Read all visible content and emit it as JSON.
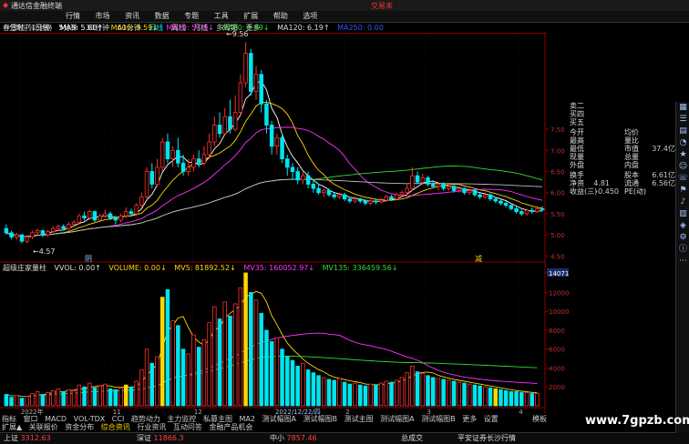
{
  "app": {
    "title": "通达信金融终端",
    "window_right_label": "交易未",
    "menu": [
      "行情",
      "市场",
      "资讯",
      "数据",
      "专题",
      "工具",
      "扩展",
      "帮助",
      "选项"
    ]
  },
  "periods": [
    "分时",
    "1分钟",
    "5分钟",
    "30分钟",
    "60分钟",
    "日线",
    "周线",
    "月线",
    "多周期",
    "更多"
  ],
  "active_period": "日线",
  "main_legend": {
    "stock": "春雪制药(日线)",
    "items": [
      {
        "label": "MA5: 5.60↑",
        "color": "#ffffff"
      },
      {
        "label": "MA10: 5.59↓",
        "color": "#ffd700"
      },
      {
        "label": "MA20: 5.75↓",
        "color": "#ff33ff"
      },
      {
        "label": "MA60: 5.89↓",
        "color": "#33dd33"
      },
      {
        "label": "MA120: 6.19↑",
        "color": "#dddddd"
      },
      {
        "label": "MA250: 0.00",
        "color": "#3355ff"
      }
    ]
  },
  "annotations": {
    "high": "9.56",
    "low": "4.57",
    "left_mark": "阴",
    "right_mark": "减"
  },
  "price_ticks": [
    "7.50",
    "7.00",
    "6.50",
    "6.00",
    "5.50",
    "5.00",
    "4.50"
  ],
  "sub_legend": {
    "title": "超级庄家量柱",
    "items": [
      {
        "label": "VVOL: 0.00↑",
        "color": "#dddddd"
      },
      {
        "label": "VOLUME: 0.00↓",
        "color": "#ffd700"
      },
      {
        "label": "MV5: 81892.52↓",
        "color": "#ffd700"
      },
      {
        "label": "MV35: 160052.97↓",
        "color": "#ff33ff"
      },
      {
        "label": "MV135: 336459.56↓",
        "color": "#33dd33"
      }
    ]
  },
  "volume_ticks": [
    "14071",
    "12000",
    "10000",
    "8000",
    "6000",
    "4000",
    "2000"
  ],
  "x_labels": [
    "2022年",
    "11",
    "12",
    "2022/12/22/四",
    "2",
    "3",
    "4"
  ],
  "quote_panel": {
    "book": [
      "卖二",
      "买四",
      "买五"
    ],
    "rows": [
      {
        "l1": "今开",
        "v1": "",
        "l2": "均价",
        "v2": ""
      },
      {
        "l1": "最高",
        "v1": "",
        "l2": "量比",
        "v2": ""
      },
      {
        "l1": "最低",
        "v1": "",
        "l2": "市值",
        "v2": "37.4亿"
      },
      {
        "l1": "现量",
        "v1": "",
        "l2": "总量",
        "v2": ""
      },
      {
        "l1": "外盘",
        "v1": "",
        "l2": "内盘",
        "v2": ""
      },
      {
        "l1": "换手",
        "v1": "",
        "l2": "股本",
        "v2": "6.61亿"
      },
      {
        "l1": "净资",
        "v1": "4.81",
        "l2": "流通",
        "v2": "6.56亿"
      },
      {
        "l1": "收益(三)",
        "v1": "-0.450",
        "l2": "PE(动)",
        "v2": ""
      }
    ]
  },
  "tabs_row1": [
    "指标",
    "窗口",
    "MACD",
    "VOL-TDX",
    "CCI",
    "趋势动力",
    "主力监控",
    "私募主图",
    "MA2",
    "测试幅图A",
    "测试幅图B",
    "测试主图",
    "测试幅图A",
    "测试幅图B",
    "更多",
    "设置"
  ],
  "tabs_row2": [
    "扩展▲",
    "关联报价",
    "资金分布",
    "综合资讯",
    "行业资讯",
    "互动问答",
    "金融产品机会"
  ],
  "tabs_row2_highlight": "综合资讯",
  "corner_labels": {
    "mode": "模板",
    "pager": "E"
  },
  "status": [
    {
      "label": "上证",
      "value": "3312.63",
      "color": "#ff4040"
    },
    {
      "label": "深证",
      "value": "11866.3",
      "color": "#ff4040"
    },
    {
      "label": "中小",
      "value": "7857.46",
      "color": "#ff4040"
    },
    {
      "label": "总成交",
      "value": "",
      "color": "#cccccc"
    },
    {
      "label": "平安证券长沙行情",
      "value": "",
      "color": "#cccccc"
    }
  ],
  "sidebar_icons": [
    "grid-icon",
    "list-icon",
    "chart-icon",
    "pie-icon",
    "star-icon",
    "user-icon",
    "phone-icon",
    "flag-icon",
    "bell-icon",
    "book-icon",
    "tag-icon",
    "gear-icon",
    "info-icon",
    "more-icon"
  ],
  "watermark": "www.7gpzb.com",
  "colors": {
    "up": "#ff3030",
    "down": "#00e5ee",
    "axis": "#8b0000",
    "accent": "#ffd700"
  },
  "chart_data": {
    "type": "candlestick+volume",
    "price_axis": {
      "ylim": [
        4.4,
        9.7
      ],
      "ticks": [
        4.5,
        5.0,
        5.5,
        6.0,
        6.5,
        7.0,
        7.5
      ]
    },
    "volume_axis": {
      "ylim": [
        0,
        14071
      ],
      "ticks": [
        2000,
        4000,
        6000,
        8000,
        10000,
        12000,
        14071
      ]
    },
    "candles": [
      [
        5.15,
        5.05,
        5.25,
        5.0
      ],
      [
        5.05,
        4.95,
        5.1,
        4.9
      ],
      [
        4.95,
        5.0,
        5.05,
        4.88
      ],
      [
        5.0,
        4.85,
        5.02,
        4.8
      ],
      [
        4.85,
        4.95,
        5.0,
        4.8
      ],
      [
        4.95,
        5.05,
        5.1,
        4.9
      ],
      [
        5.05,
        5.1,
        5.15,
        5.0
      ],
      [
        5.1,
        5.0,
        5.12,
        4.95
      ],
      [
        5.0,
        5.08,
        5.12,
        4.95
      ],
      [
        5.08,
        5.15,
        5.2,
        5.05
      ],
      [
        5.15,
        5.2,
        5.25,
        5.1
      ],
      [
        5.2,
        5.15,
        5.25,
        5.1
      ],
      [
        5.15,
        5.25,
        5.3,
        5.1
      ],
      [
        5.25,
        5.3,
        5.35,
        5.2
      ],
      [
        5.3,
        5.45,
        5.5,
        5.25
      ],
      [
        5.45,
        5.4,
        5.55,
        5.35
      ],
      [
        5.4,
        5.55,
        5.6,
        5.35
      ],
      [
        5.55,
        5.35,
        5.58,
        5.3
      ],
      [
        5.35,
        5.45,
        5.5,
        5.3
      ],
      [
        5.45,
        5.5,
        5.6,
        5.4
      ],
      [
        5.5,
        5.4,
        5.55,
        5.35
      ],
      [
        5.4,
        5.35,
        5.45,
        5.25
      ],
      [
        5.35,
        5.45,
        5.5,
        5.3
      ],
      [
        5.45,
        5.55,
        5.65,
        5.4
      ],
      [
        5.55,
        5.5,
        5.62,
        5.45
      ],
      [
        5.5,
        5.7,
        5.75,
        5.45
      ],
      [
        5.7,
        5.9,
        6.0,
        5.65
      ],
      [
        5.9,
        6.5,
        6.6,
        5.85
      ],
      [
        6.5,
        6.2,
        6.7,
        6.1
      ],
      [
        6.2,
        6.6,
        6.8,
        6.15
      ],
      [
        6.6,
        7.2,
        7.3,
        6.5
      ],
      [
        7.2,
        6.8,
        7.4,
        6.7
      ],
      [
        6.8,
        7.0,
        7.1,
        6.6
      ],
      [
        7.0,
        6.7,
        7.3,
        6.6
      ],
      [
        6.7,
        6.5,
        6.9,
        6.4
      ],
      [
        6.5,
        6.6,
        6.8,
        6.4
      ],
      [
        6.6,
        6.8,
        6.9,
        6.5
      ],
      [
        6.8,
        6.7,
        7.0,
        6.6
      ],
      [
        6.7,
        6.9,
        7.1,
        6.65
      ],
      [
        6.9,
        7.2,
        7.4,
        6.8
      ],
      [
        7.2,
        7.6,
        7.8,
        7.1
      ],
      [
        7.6,
        7.4,
        7.9,
        7.3
      ],
      [
        7.4,
        7.8,
        8.0,
        7.35
      ],
      [
        7.8,
        7.5,
        8.2,
        7.4
      ],
      [
        7.5,
        7.9,
        8.3,
        7.45
      ],
      [
        7.9,
        8.6,
        8.8,
        7.85
      ],
      [
        8.6,
        9.3,
        9.56,
        8.5
      ],
      [
        9.3,
        8.4,
        9.4,
        8.3
      ],
      [
        8.4,
        8.8,
        9.0,
        8.2
      ],
      [
        8.8,
        8.1,
        8.9,
        7.9
      ],
      [
        8.1,
        7.6,
        8.2,
        7.4
      ],
      [
        7.6,
        7.1,
        7.7,
        6.9
      ],
      [
        7.1,
        7.3,
        7.4,
        6.9
      ],
      [
        7.3,
        6.8,
        7.4,
        6.7
      ],
      [
        6.8,
        6.6,
        6.9,
        6.4
      ],
      [
        6.6,
        6.5,
        6.7,
        6.3
      ],
      [
        6.5,
        6.3,
        6.6,
        6.2
      ],
      [
        6.3,
        6.4,
        6.5,
        6.2
      ],
      [
        6.4,
        6.2,
        6.5,
        6.1
      ],
      [
        6.2,
        6.1,
        6.3,
        6.0
      ],
      [
        6.1,
        6.0,
        6.2,
        5.95
      ],
      [
        6.0,
        6.05,
        6.1,
        5.9
      ],
      [
        6.05,
        5.95,
        6.1,
        5.9
      ],
      [
        5.95,
        5.9,
        6.0,
        5.85
      ],
      [
        5.9,
        5.95,
        6.0,
        5.85
      ],
      [
        5.95,
        5.85,
        6.0,
        5.8
      ],
      [
        5.85,
        5.8,
        5.9,
        5.75
      ],
      [
        5.8,
        5.85,
        5.9,
        5.75
      ],
      [
        5.85,
        5.8,
        5.88,
        5.75
      ],
      [
        5.8,
        5.75,
        5.85,
        5.7
      ],
      [
        5.75,
        5.8,
        5.85,
        5.7
      ],
      [
        5.8,
        5.78,
        5.85,
        5.72
      ],
      [
        5.78,
        5.82,
        5.88,
        5.74
      ],
      [
        5.82,
        5.9,
        5.95,
        5.78
      ],
      [
        5.9,
        5.85,
        5.95,
        5.8
      ],
      [
        5.85,
        5.95,
        6.0,
        5.82
      ],
      [
        5.95,
        6.0,
        6.05,
        5.9
      ],
      [
        6.0,
        6.1,
        6.2,
        5.95
      ],
      [
        6.1,
        6.4,
        6.6,
        6.05
      ],
      [
        6.4,
        6.25,
        6.5,
        6.2
      ],
      [
        6.25,
        6.35,
        6.45,
        6.2
      ],
      [
        6.35,
        6.2,
        6.4,
        6.15
      ],
      [
        6.2,
        6.15,
        6.3,
        6.1
      ],
      [
        6.15,
        6.2,
        6.25,
        6.05
      ],
      [
        6.2,
        6.1,
        6.25,
        6.05
      ],
      [
        6.1,
        6.15,
        6.2,
        6.05
      ],
      [
        6.15,
        6.05,
        6.18,
        6.0
      ],
      [
        6.05,
        6.1,
        6.15,
        6.0
      ],
      [
        6.1,
        6.0,
        6.12,
        5.95
      ],
      [
        6.0,
        6.05,
        6.1,
        5.95
      ],
      [
        6.05,
        5.95,
        6.08,
        5.9
      ],
      [
        5.95,
        5.9,
        6.0,
        5.85
      ],
      [
        5.9,
        5.95,
        6.0,
        5.85
      ],
      [
        5.95,
        5.85,
        5.98,
        5.8
      ],
      [
        5.85,
        5.8,
        5.9,
        5.75
      ],
      [
        5.8,
        5.75,
        5.85,
        5.7
      ],
      [
        5.75,
        5.7,
        5.8,
        5.65
      ],
      [
        5.7,
        5.62,
        5.75,
        5.58
      ],
      [
        5.62,
        5.55,
        5.68,
        5.5
      ],
      [
        5.55,
        5.5,
        5.6,
        5.45
      ],
      [
        5.5,
        5.58,
        5.62,
        5.45
      ],
      [
        5.58,
        5.55,
        5.65,
        5.5
      ],
      [
        5.55,
        5.62,
        5.68,
        5.52
      ],
      [
        5.62,
        5.6,
        5.68,
        5.55
      ]
    ],
    "volumes": [
      1200,
      900,
      1100,
      800,
      1000,
      1300,
      1500,
      1200,
      1400,
      1600,
      1800,
      1500,
      1700,
      1600,
      2200,
      2000,
      2400,
      1900,
      2100,
      2300,
      1800,
      1700,
      1900,
      2200,
      2000,
      2600,
      3800,
      6000,
      4500,
      5200,
      11500,
      12300,
      9000,
      8500,
      6000,
      5500,
      7500,
      6200,
      7000,
      8800,
      10500,
      9200,
      11000,
      9500,
      10800,
      12500,
      14071,
      12000,
      11200,
      9800,
      8000,
      6800,
      7200,
      6000,
      5200,
      4800,
      4200,
      4500,
      3800,
      3500,
      3200,
      3000,
      2800,
      2700,
      2900,
      2500,
      2300,
      2400,
      2200,
      2100,
      2300,
      2200,
      2400,
      2600,
      2500,
      2700,
      3000,
      3500,
      4200,
      3600,
      3400,
      3200,
      3000,
      2900,
      2800,
      2700,
      2600,
      2500,
      2400,
      2300,
      2200,
      2100,
      2000,
      1900,
      1800,
      1700,
      1600,
      1500,
      1500,
      1400,
      1400,
      1300,
      1300
    ],
    "highlight_bars": [
      23,
      30,
      46,
      94
    ]
  }
}
